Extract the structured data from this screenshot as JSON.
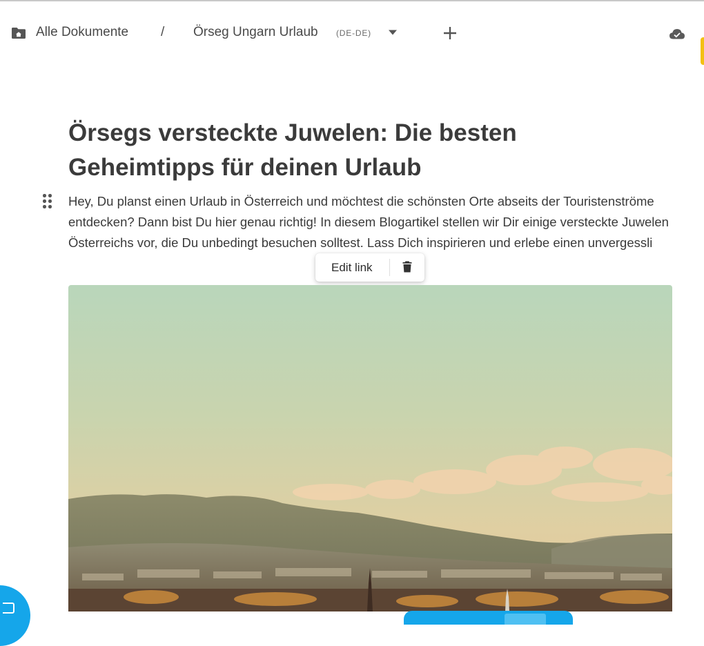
{
  "header": {
    "breadcrumb_root": "Alle Dokumente",
    "separator": "/",
    "document_title": "Örseg Ungarn Urlaub",
    "locale": "(DE-DE)",
    "icons": {
      "folder": "folder-home-icon",
      "caret": "caret-down-icon",
      "add": "plus-icon",
      "sync": "cloud-check-icon"
    }
  },
  "article": {
    "title": "Örsegs versteckte Juwelen: Die besten Geheimtipps für deinen Urlaub",
    "paragraph": "Hey, Du planst einen Urlaub in Österreich und möchtest die schönsten Orte abseits der Touristenströme entdecken? Dann bist Du hier genau richtig! In diesem Blogartikel stellen wir Dir einige versteckte Juwelen Österreichs vor, die Du unbedingt besuchen solltest. Lass Dich inspirieren und erlebe einen unvergessli"
  },
  "link_popover": {
    "edit_label": "Edit link",
    "delete_icon": "trash-icon"
  },
  "colors": {
    "accent_blue": "#15a6ea",
    "accent_yellow": "#f3c012",
    "text_primary": "#3b3b3b"
  }
}
